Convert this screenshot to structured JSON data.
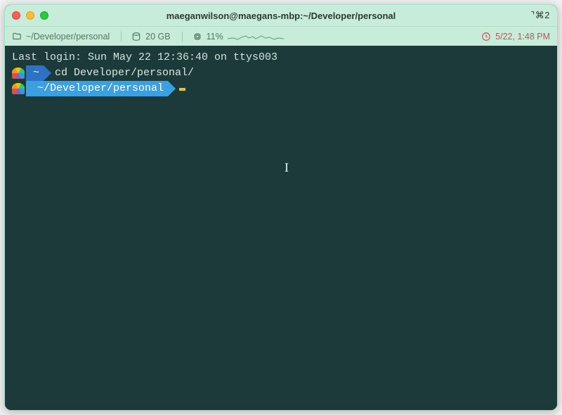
{
  "titlebar": {
    "title": "maeganwilson@maegans-mbp:~/Developer/personal",
    "shortcut": "⌝⌘2"
  },
  "statusbar": {
    "cwd": "~/Developer/personal",
    "disk": "20 GB",
    "cpu": "11%",
    "datetime": "5/22, 1:48 PM"
  },
  "terminal": {
    "last_login": "Last login: Sun May 22 12:36:40 on ttys003",
    "line1": {
      "home": "~",
      "command": "cd Developer/personal/"
    },
    "line2": {
      "path": "~/Developer/personal"
    }
  }
}
